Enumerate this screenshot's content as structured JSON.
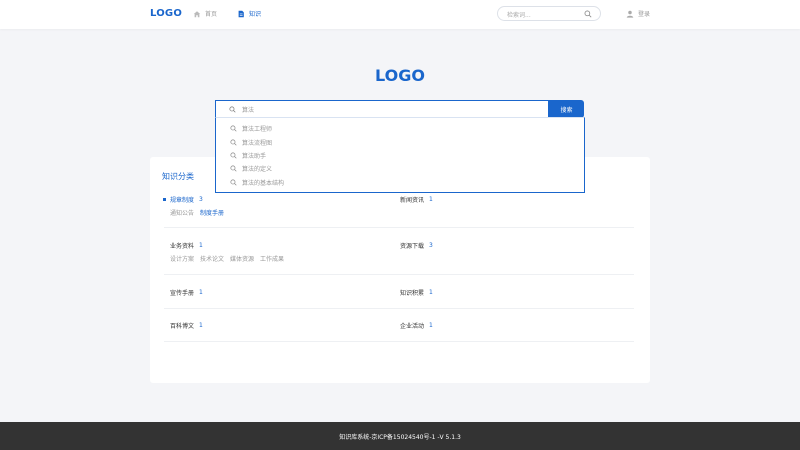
{
  "header": {
    "logo": "LOGO",
    "nav": [
      {
        "label": "首页",
        "icon": "home-icon",
        "active": false
      },
      {
        "label": "知识",
        "icon": "document-icon",
        "active": true
      }
    ],
    "search_placeholder": "检索词...",
    "login": "登录"
  },
  "hero": {
    "logo": "LOGO",
    "search_value": "算法",
    "search_button": "搜索"
  },
  "suggestions": [
    "算法工程师",
    "算法流程图",
    "算法助手",
    "算法的定义",
    "算法的基本结构"
  ],
  "categories": {
    "title": "知识分类",
    "items": [
      {
        "label": "规章制度",
        "count": "3",
        "active": true,
        "subs": [
          {
            "label": "通知公告",
            "on": false
          },
          {
            "label": "制度手册",
            "on": true
          }
        ]
      },
      {
        "label": "新闻资讯",
        "count": "1",
        "active": false,
        "subs": []
      },
      {
        "label": "业务资料",
        "count": "1",
        "active": false,
        "subs": [
          {
            "label": "设计方案",
            "on": false
          },
          {
            "label": "技术论文",
            "on": false
          },
          {
            "label": "媒体资源",
            "on": false
          },
          {
            "label": "工作成果",
            "on": false
          }
        ]
      },
      {
        "label": "资源下载",
        "count": "3",
        "active": false,
        "subs": []
      },
      {
        "label": "宣传手册",
        "count": "1",
        "active": false,
        "subs": []
      },
      {
        "label": "知识积累",
        "count": "1",
        "active": false,
        "subs": []
      },
      {
        "label": "百科博文",
        "count": "1",
        "active": false,
        "subs": []
      },
      {
        "label": "企业活动",
        "count": "1",
        "active": false,
        "subs": []
      }
    ]
  },
  "footer": "知识库系统-京ICP备15024540号-1 -V 5.1.3",
  "colors": {
    "accent": "#1a66cc",
    "footer_bg": "#333333"
  }
}
